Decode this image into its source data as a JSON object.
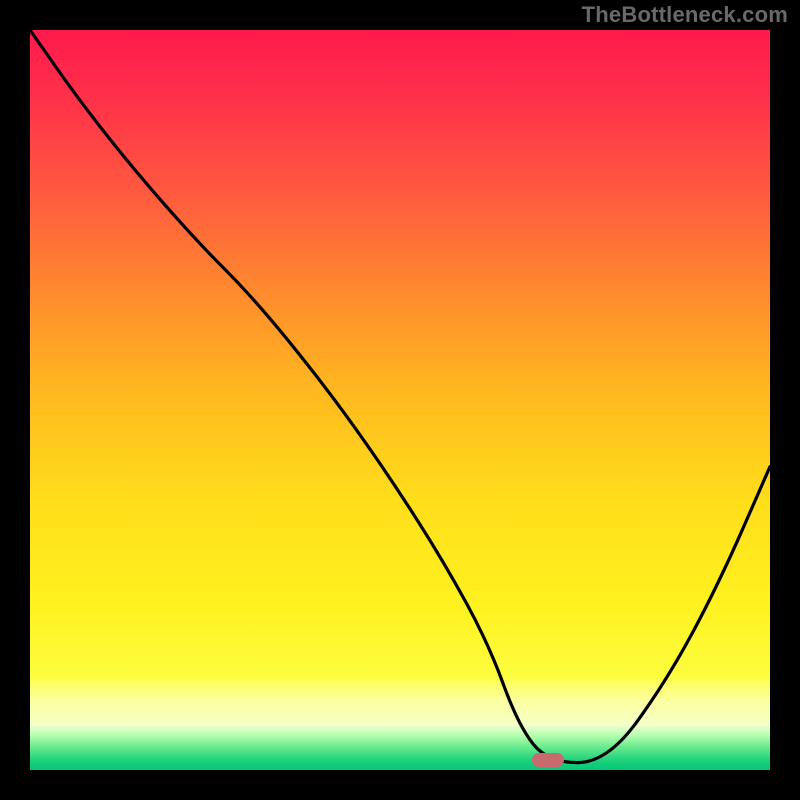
{
  "watermark": "TheBottleneck.com",
  "colors": {
    "background": "#000000",
    "watermark": "#696969",
    "curve": "#000000",
    "marker": "#c96a6f",
    "gradient_top": "#ff1a4d",
    "gradient_mid": "#ffde1a",
    "gradient_bottom": "#06c877"
  },
  "chart_data": {
    "type": "line",
    "title": "",
    "xlabel": "",
    "ylabel": "",
    "xlim": [
      0,
      100
    ],
    "ylim": [
      0,
      100
    ],
    "grid": false,
    "legend": false,
    "series": [
      {
        "name": "bottleneck-curve",
        "x": [
          0,
          7,
          15,
          23,
          29,
          35,
          42,
          49,
          56,
          62,
          66,
          70,
          78,
          86,
          93,
          100
        ],
        "y": [
          100,
          90,
          80,
          71,
          65,
          58,
          49,
          39,
          28,
          17,
          6,
          1,
          1,
          12,
          25,
          41
        ]
      }
    ],
    "marker": {
      "x": 70,
      "y": 1
    },
    "bands": [
      {
        "name": "red-yellow-gradient",
        "y_from": 12,
        "y_to": 100
      },
      {
        "name": "pale-yellow",
        "y_from": 6,
        "y_to": 12
      },
      {
        "name": "green-stripes",
        "y_from": 0,
        "y_to": 6
      }
    ]
  }
}
